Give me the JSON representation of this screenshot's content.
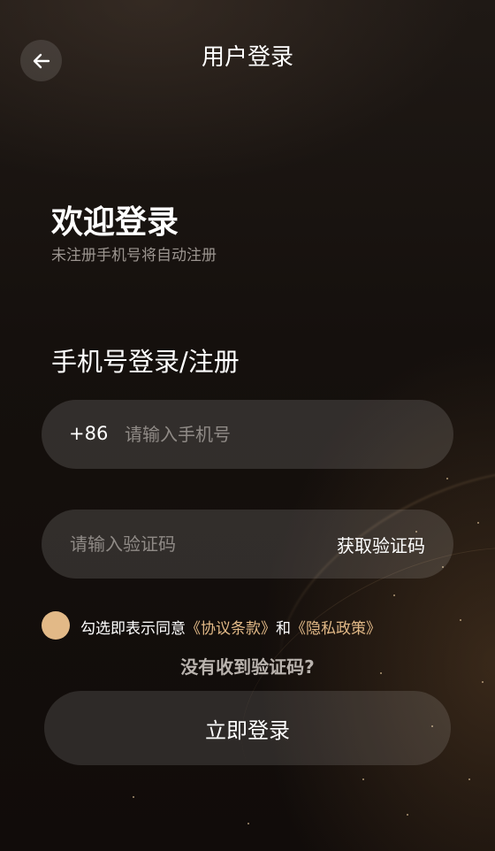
{
  "header": {
    "title": "用户登录",
    "back_icon": "arrow-left-icon"
  },
  "welcome": {
    "title": "欢迎登录",
    "subtitle": "未注册手机号将自动注册"
  },
  "section": {
    "title": "手机号登录/注册"
  },
  "phone_field": {
    "prefix": "+86",
    "placeholder": "请输入手机号",
    "value": ""
  },
  "code_field": {
    "placeholder": "请输入验证码",
    "value": "",
    "get_code_label": "获取验证码"
  },
  "agreement": {
    "checked": true,
    "prefix": "勾选即表示同意",
    "terms_link": "《协议条款》",
    "conjunction": "和",
    "privacy_link": "《隐私政策》"
  },
  "resend_label": "没有收到验证码?",
  "submit_label": "立即登录",
  "colors": {
    "accent": "#e2b987",
    "background": "#110d0b",
    "field_bg": "#2a2623"
  }
}
